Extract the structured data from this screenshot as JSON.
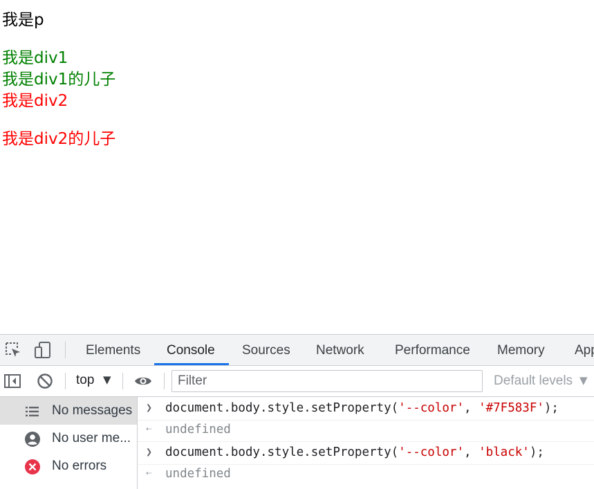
{
  "page": {
    "lines": [
      "我是p",
      "我是div1",
      "我是div1的儿子",
      "我是div2",
      "我是div2的儿子"
    ]
  },
  "colors": {
    "green_text": "#008000",
    "red_text": "#ff0000",
    "tab_active_underline": "#1a73e8",
    "console_string": "#c80000"
  },
  "devtools": {
    "icons": [
      "inspect-element-icon",
      "device-toolbar-icon",
      "sidebar-toggle-icon",
      "clear-console-icon",
      "eye-icon",
      "message-list-icon",
      "user-icon",
      "error-icon"
    ],
    "tabs": [
      "Elements",
      "Console",
      "Sources",
      "Network",
      "Performance",
      "Memory",
      "App"
    ],
    "active_tab": "Console",
    "toolbar": {
      "context": "top",
      "filter_placeholder": "Filter",
      "levels": "Default levels"
    },
    "sidebar": {
      "items": [
        {
          "label": "No messages",
          "icon": "message-list-icon"
        },
        {
          "label": "No user me...",
          "icon": "user-icon"
        },
        {
          "label": "No errors",
          "icon": "error-icon"
        }
      ]
    },
    "console": {
      "entries": [
        {
          "type": "input",
          "pre": "document.body.style.setProperty(",
          "arg1": "'--color'",
          "sep": ", ",
          "arg2": "'#7F583F'",
          "post": ");"
        },
        {
          "type": "output",
          "text": "undefined"
        },
        {
          "type": "input",
          "pre": "document.body.style.setProperty(",
          "arg1": "'--color'",
          "sep": ", ",
          "arg2": "'black'",
          "post": ");"
        },
        {
          "type": "output",
          "text": "undefined"
        }
      ]
    }
  }
}
